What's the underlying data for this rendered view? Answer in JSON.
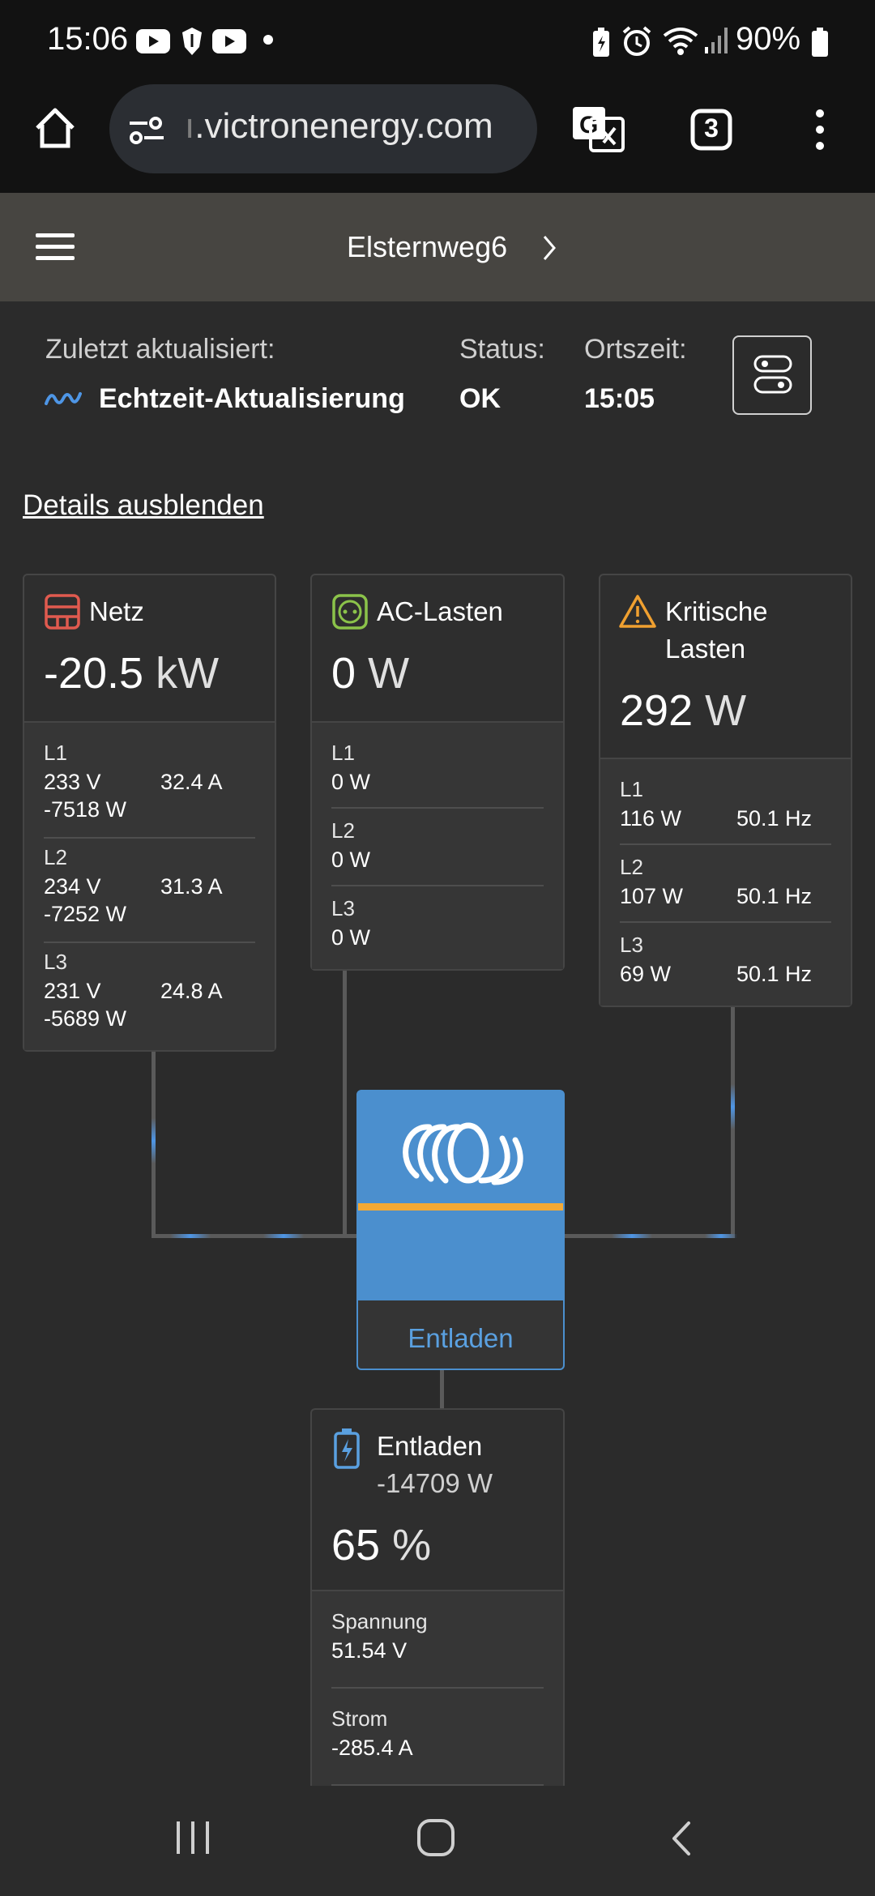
{
  "status_bar": {
    "time": "15:06",
    "battery": "90%"
  },
  "browser": {
    "url_prefix": "ı",
    "url": ".victronenergy.com",
    "tab_count": "3"
  },
  "header": {
    "site_name": "Elsternweg6"
  },
  "info": {
    "updated_label": "Zuletzt aktualisiert:",
    "updated_value": "Echtzeit-Aktualisierung",
    "status_label": "Status:",
    "status_value": "OK",
    "time_label": "Ortszeit:",
    "time_value": "15:05"
  },
  "details_link": "Details ausblenden",
  "grid": {
    "title": "Netz",
    "value": "-20.5",
    "unit": "kW",
    "phases": [
      {
        "label": "L1",
        "voltage": "233 V",
        "current": "32.4 A",
        "power": "-7518 W"
      },
      {
        "label": "L2",
        "voltage": "234 V",
        "current": "31.3 A",
        "power": "-7252 W"
      },
      {
        "label": "L3",
        "voltage": "231 V",
        "current": "24.8 A",
        "power": "-5689 W"
      }
    ]
  },
  "ac_loads": {
    "title": "AC-Lasten",
    "value": "0",
    "unit": "W",
    "phases": [
      {
        "label": "L1",
        "power": "0 W"
      },
      {
        "label": "L2",
        "power": "0 W"
      },
      {
        "label": "L3",
        "power": "0 W"
      }
    ]
  },
  "critical_loads": {
    "title_line1": "Kritische",
    "title_line2": "Lasten",
    "value": "292",
    "unit": "W",
    "phases": [
      {
        "label": "L1",
        "power": "116 W",
        "frequency": "50.1 Hz"
      },
      {
        "label": "L2",
        "power": "107 W",
        "frequency": "50.1 Hz"
      },
      {
        "label": "L3",
        "power": "69 W",
        "frequency": "50.1 Hz"
      }
    ]
  },
  "inverter": {
    "state": "Entladen"
  },
  "battery": {
    "title": "Entladen",
    "power": "-14709 W",
    "soc": "65",
    "soc_unit": "%",
    "rows": [
      {
        "label": "Spannung",
        "value": "51.54 V"
      },
      {
        "label": "Strom",
        "value": "-285.4 A"
      }
    ]
  },
  "colors": {
    "grid_icon": "#e05a4f",
    "ac_icon": "#8bc34a",
    "warning_icon": "#f0a030",
    "battery_icon": "#5aa0e0",
    "victron_blue": "#4b8fce",
    "victron_orange": "#f3a935",
    "flow": "#4e96e6"
  }
}
